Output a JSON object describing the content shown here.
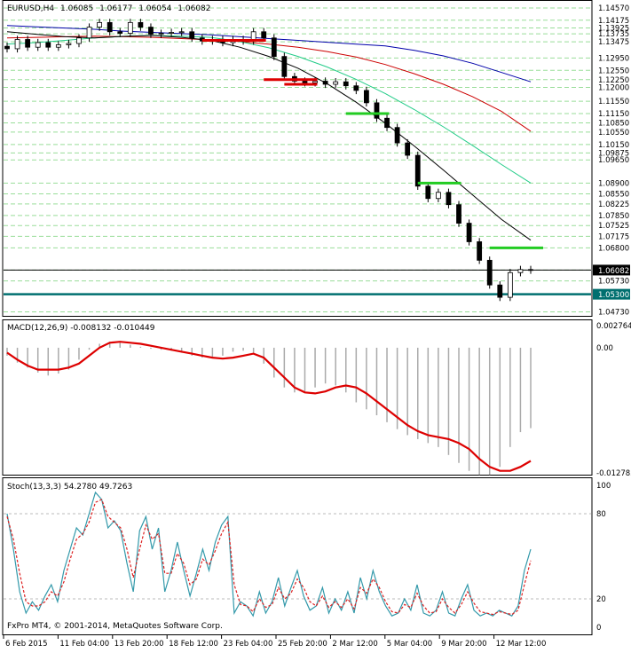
{
  "chart_data": [
    {
      "type": "candlestick",
      "header": {
        "symbol": "EURUSD,H4",
        "open": "1.06085",
        "high": "1.06177",
        "low": "1.06054",
        "close": "1.06082"
      },
      "price_ticks": [
        "1.14570",
        "1.14175",
        "1.13925",
        "1.13735",
        "1.13475",
        "1.12950",
        "1.12550",
        "1.12250",
        "1.12000",
        "1.11550",
        "1.11150",
        "1.10850",
        "1.10550",
        "1.10150",
        "1.09875",
        "1.09650",
        "1.08900",
        "1.08550",
        "1.08225",
        "1.07850",
        "1.07525",
        "1.07175",
        "1.06800",
        "1.06082",
        "1.05730",
        "1.05300",
        "1.04730"
      ],
      "current_price": 1.06082,
      "current_price_label": "1.06082",
      "support_line": 1.053,
      "support_line_label": "1.05300",
      "ylim": [
        1.046,
        1.148
      ],
      "x_labels": [
        "6 Feb 2015",
        "11 Feb 04:00",
        "13 Feb 20:00",
        "18 Feb 12:00",
        "23 Feb 04:00",
        "25 Feb 20:00",
        "2 Mar 12:00",
        "5 Mar 04:00",
        "9 Mar 20:00",
        "12 Mar 12:00"
      ],
      "close_series": [
        1.1325,
        1.1355,
        1.133,
        1.1345,
        1.133,
        1.1338,
        1.1342,
        1.136,
        1.1395,
        1.141,
        1.138,
        1.1375,
        1.141,
        1.1395,
        1.1372,
        1.1375,
        1.1378,
        1.138,
        1.136,
        1.135,
        1.1355,
        1.1345,
        1.1355,
        1.135,
        1.138,
        1.136,
        1.13,
        1.1235,
        1.122,
        1.1215,
        1.122,
        1.121,
        1.1218,
        1.1205,
        1.119,
        1.115,
        1.11,
        1.107,
        1.102,
        1.098,
        1.088,
        1.084,
        1.086,
        1.082,
        1.076,
        1.07,
        1.064,
        1.056,
        1.052,
        1.06,
        1.061,
        1.0608
      ],
      "moving_averages": [
        {
          "color": "#0000aa",
          "values": [
            1.14,
            1.1396,
            1.1392,
            1.1388,
            1.1382,
            1.1378,
            1.1374,
            1.137,
            1.1364,
            1.1358,
            1.1352,
            1.1346,
            1.134,
            1.1334,
            1.132,
            1.1302,
            1.1278,
            1.1248,
            1.1218
          ]
        },
        {
          "color": "#cc0000",
          "values": [
            1.136,
            1.1362,
            1.1364,
            1.1366,
            1.1364,
            1.1362,
            1.1358,
            1.1354,
            1.1348,
            1.134,
            1.133,
            1.1316,
            1.1298,
            1.1274,
            1.1244,
            1.121,
            1.117,
            1.1122,
            1.1058
          ]
        },
        {
          "color": "#22cc88",
          "values": [
            1.134,
            1.1345,
            1.1352,
            1.136,
            1.1365,
            1.1368,
            1.1366,
            1.1362,
            1.1348,
            1.1328,
            1.13,
            1.1266,
            1.1226,
            1.118,
            1.1128,
            1.1072,
            1.1012,
            1.095,
            1.089
          ]
        },
        {
          "color": "#000000",
          "values": [
            1.138,
            1.1372,
            1.1364,
            1.136,
            1.1365,
            1.1368,
            1.1362,
            1.1352,
            1.133,
            1.13,
            1.1262,
            1.1212,
            1.1152,
            1.1084,
            1.101,
            1.0932,
            1.0852,
            1.0772,
            1.0705
          ]
        }
      ],
      "resistance_segments": [
        {
          "from": 19,
          "to": 24,
          "price": 1.1352,
          "color": "#dd0000"
        },
        {
          "from": 25,
          "to": 29,
          "price": 1.1225,
          "color": "#dd0000"
        },
        {
          "from": 27,
          "to": 29,
          "price": 1.121,
          "color": "#dd0000"
        },
        {
          "from": 33,
          "to": 36,
          "price": 1.1115,
          "color": "#22cc22"
        },
        {
          "from": 40,
          "to": 43,
          "price": 1.089,
          "color": "#22cc22"
        },
        {
          "from": 47,
          "to": 52,
          "price": 1.068,
          "color": "#22cc22"
        }
      ]
    },
    {
      "type": "line",
      "title": "MACD(12,26,9) -0.008132 -0.010449",
      "y_ticks": [
        "0.002764",
        "0.00",
        "-0.012783"
      ],
      "ylim": [
        -0.012783,
        0.002764
      ],
      "histogram": [
        -0.0008,
        -0.0015,
        -0.002,
        -0.0025,
        -0.0028,
        -0.0026,
        -0.0022,
        -0.0012,
        -0.0002,
        0.0004,
        0.0006,
        0.0005,
        0.0003,
        0.0001,
        -0.0001,
        -0.0002,
        -0.0003,
        -0.0005,
        -0.0008,
        -0.001,
        -0.001,
        -0.0008,
        -0.0004,
        -0.0003,
        -0.0005,
        -0.0016,
        -0.003,
        -0.004,
        -0.0045,
        -0.0044,
        -0.004,
        -0.0036,
        -0.0038,
        -0.0045,
        -0.0055,
        -0.0062,
        -0.0068,
        -0.0075,
        -0.0082,
        -0.0088,
        -0.0092,
        -0.0096,
        -0.01,
        -0.0108,
        -0.0116,
        -0.0124,
        -0.0128,
        -0.0128,
        -0.012,
        -0.01,
        -0.0085,
        -0.0081
      ],
      "signal": [
        -0.0005,
        -0.0012,
        -0.0018,
        -0.0022,
        -0.0022,
        -0.0022,
        -0.002,
        -0.0016,
        -0.0008,
        0.0,
        0.0005,
        0.0006,
        0.0005,
        0.0004,
        0.0002,
        0.0,
        -0.0002,
        -0.0004,
        -0.0006,
        -0.0008,
        -0.001,
        -0.0011,
        -0.001,
        -0.0008,
        -0.0006,
        -0.001,
        -0.002,
        -0.003,
        -0.004,
        -0.0045,
        -0.0046,
        -0.0044,
        -0.004,
        -0.0038,
        -0.004,
        -0.0046,
        -0.0054,
        -0.0062,
        -0.007,
        -0.0078,
        -0.0084,
        -0.0088,
        -0.009,
        -0.0092,
        -0.0096,
        -0.0102,
        -0.0112,
        -0.012,
        -0.0124,
        -0.0124,
        -0.012,
        -0.0114
      ]
    },
    {
      "type": "line",
      "title": "Stoch(13,3,3) 54.2780 49.7263",
      "y_ticks": [
        "100",
        "80",
        "20",
        "0"
      ],
      "ylim": [
        0,
        100
      ],
      "main": [
        80,
        55,
        25,
        10,
        18,
        12,
        22,
        30,
        18,
        40,
        55,
        70,
        65,
        80,
        95,
        90,
        70,
        75,
        68,
        45,
        25,
        68,
        78,
        55,
        70,
        25,
        40,
        60,
        40,
        22,
        38,
        55,
        40,
        60,
        72,
        78,
        10,
        18,
        15,
        8,
        25,
        10,
        18,
        35,
        15,
        28,
        40,
        22,
        12,
        15,
        28,
        10,
        20,
        12,
        25,
        10,
        35,
        20,
        40,
        25,
        15,
        8,
        10,
        20,
        12,
        30,
        10,
        8,
        12,
        25,
        10,
        8,
        20,
        30,
        12,
        8,
        10,
        8,
        12,
        10,
        8,
        15,
        40,
        55
      ],
      "signal": [
        78,
        62,
        38,
        18,
        15,
        15,
        18,
        25,
        22,
        32,
        48,
        62,
        66,
        74,
        88,
        90,
        78,
        74,
        70,
        55,
        35,
        55,
        72,
        62,
        66,
        38,
        38,
        52,
        45,
        30,
        34,
        48,
        44,
        54,
        66,
        74,
        30,
        16,
        15,
        11,
        20,
        14,
        16,
        28,
        20,
        24,
        34,
        28,
        18,
        15,
        22,
        14,
        18,
        14,
        20,
        13,
        28,
        24,
        34,
        28,
        18,
        11,
        10,
        16,
        14,
        24,
        15,
        10,
        11,
        20,
        14,
        10,
        16,
        25,
        17,
        11,
        10,
        9,
        11,
        10,
        9,
        12,
        30,
        47
      ]
    }
  ],
  "footer": {
    "copyright": "FxPro MT4, © 2001-2014, MetaQuotes Software Corp."
  },
  "colors": {
    "grid": "#99dd99",
    "candle": "#000000",
    "support": "#006f6f",
    "macd_signal": "#dd0000",
    "stoch_main": "#3399aa",
    "stoch_signal": "#dd2222"
  }
}
